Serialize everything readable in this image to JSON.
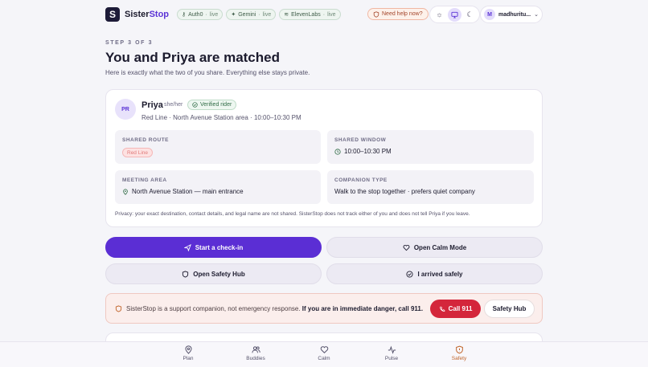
{
  "header": {
    "brand_prefix": "Sister",
    "brand_suffix": "Stop",
    "logo_letter": "S",
    "pills": [
      {
        "name": "Auth0",
        "status": "live"
      },
      {
        "name": "Gemini",
        "status": "live"
      },
      {
        "name": "ElevenLabs",
        "status": "live"
      }
    ],
    "help": "Need help now?",
    "user_initial": "M",
    "user_name": "madhuritu..."
  },
  "intro": {
    "step": "STEP 3 OF 3",
    "title": "You and Priya are matched",
    "subtitle": "Here is exactly what the two of you share. Everything else stays private."
  },
  "match": {
    "initials": "PR",
    "name": "Priya",
    "pronouns": "she/her",
    "verified": "Verified rider",
    "route_summary": "Red Line · North Avenue Station area · 10:00–10:30 PM",
    "tiles": {
      "route_label": "SHARED ROUTE",
      "route_value": "Red Line",
      "window_label": "SHARED WINDOW",
      "window_value": "10:00–10:30 PM",
      "meeting_label": "MEETING AREA",
      "meeting_value": "North Avenue Station — main entrance",
      "companion_label": "COMPANION TYPE",
      "companion_value": "Walk to the stop together · prefers quiet company"
    },
    "privacy": "Privacy: your exact destination, contact details, and legal name are not shared. SisterStop does not track either of you and does not tell Priya if you leave."
  },
  "actions": {
    "checkin": "Start a check-in",
    "calm": "Open Calm Mode",
    "safety_hub": "Open Safety Hub",
    "arrived": "I arrived safely"
  },
  "alert": {
    "text_plain": "SisterStop is a support companion, not emergency response.",
    "text_bold": "If you are in immediate danger, call 911.",
    "call": "Call 911",
    "hub": "Safety Hub"
  },
  "nav": {
    "items": [
      {
        "label": "Plan"
      },
      {
        "label": "Buddies"
      },
      {
        "label": "Calm"
      },
      {
        "label": "Pulse"
      },
      {
        "label": "Safety"
      }
    ],
    "active": "Safety"
  },
  "colors": {
    "accent": "#5b2ed4",
    "danger": "#d4263b",
    "safety_active": "#c0642a"
  }
}
